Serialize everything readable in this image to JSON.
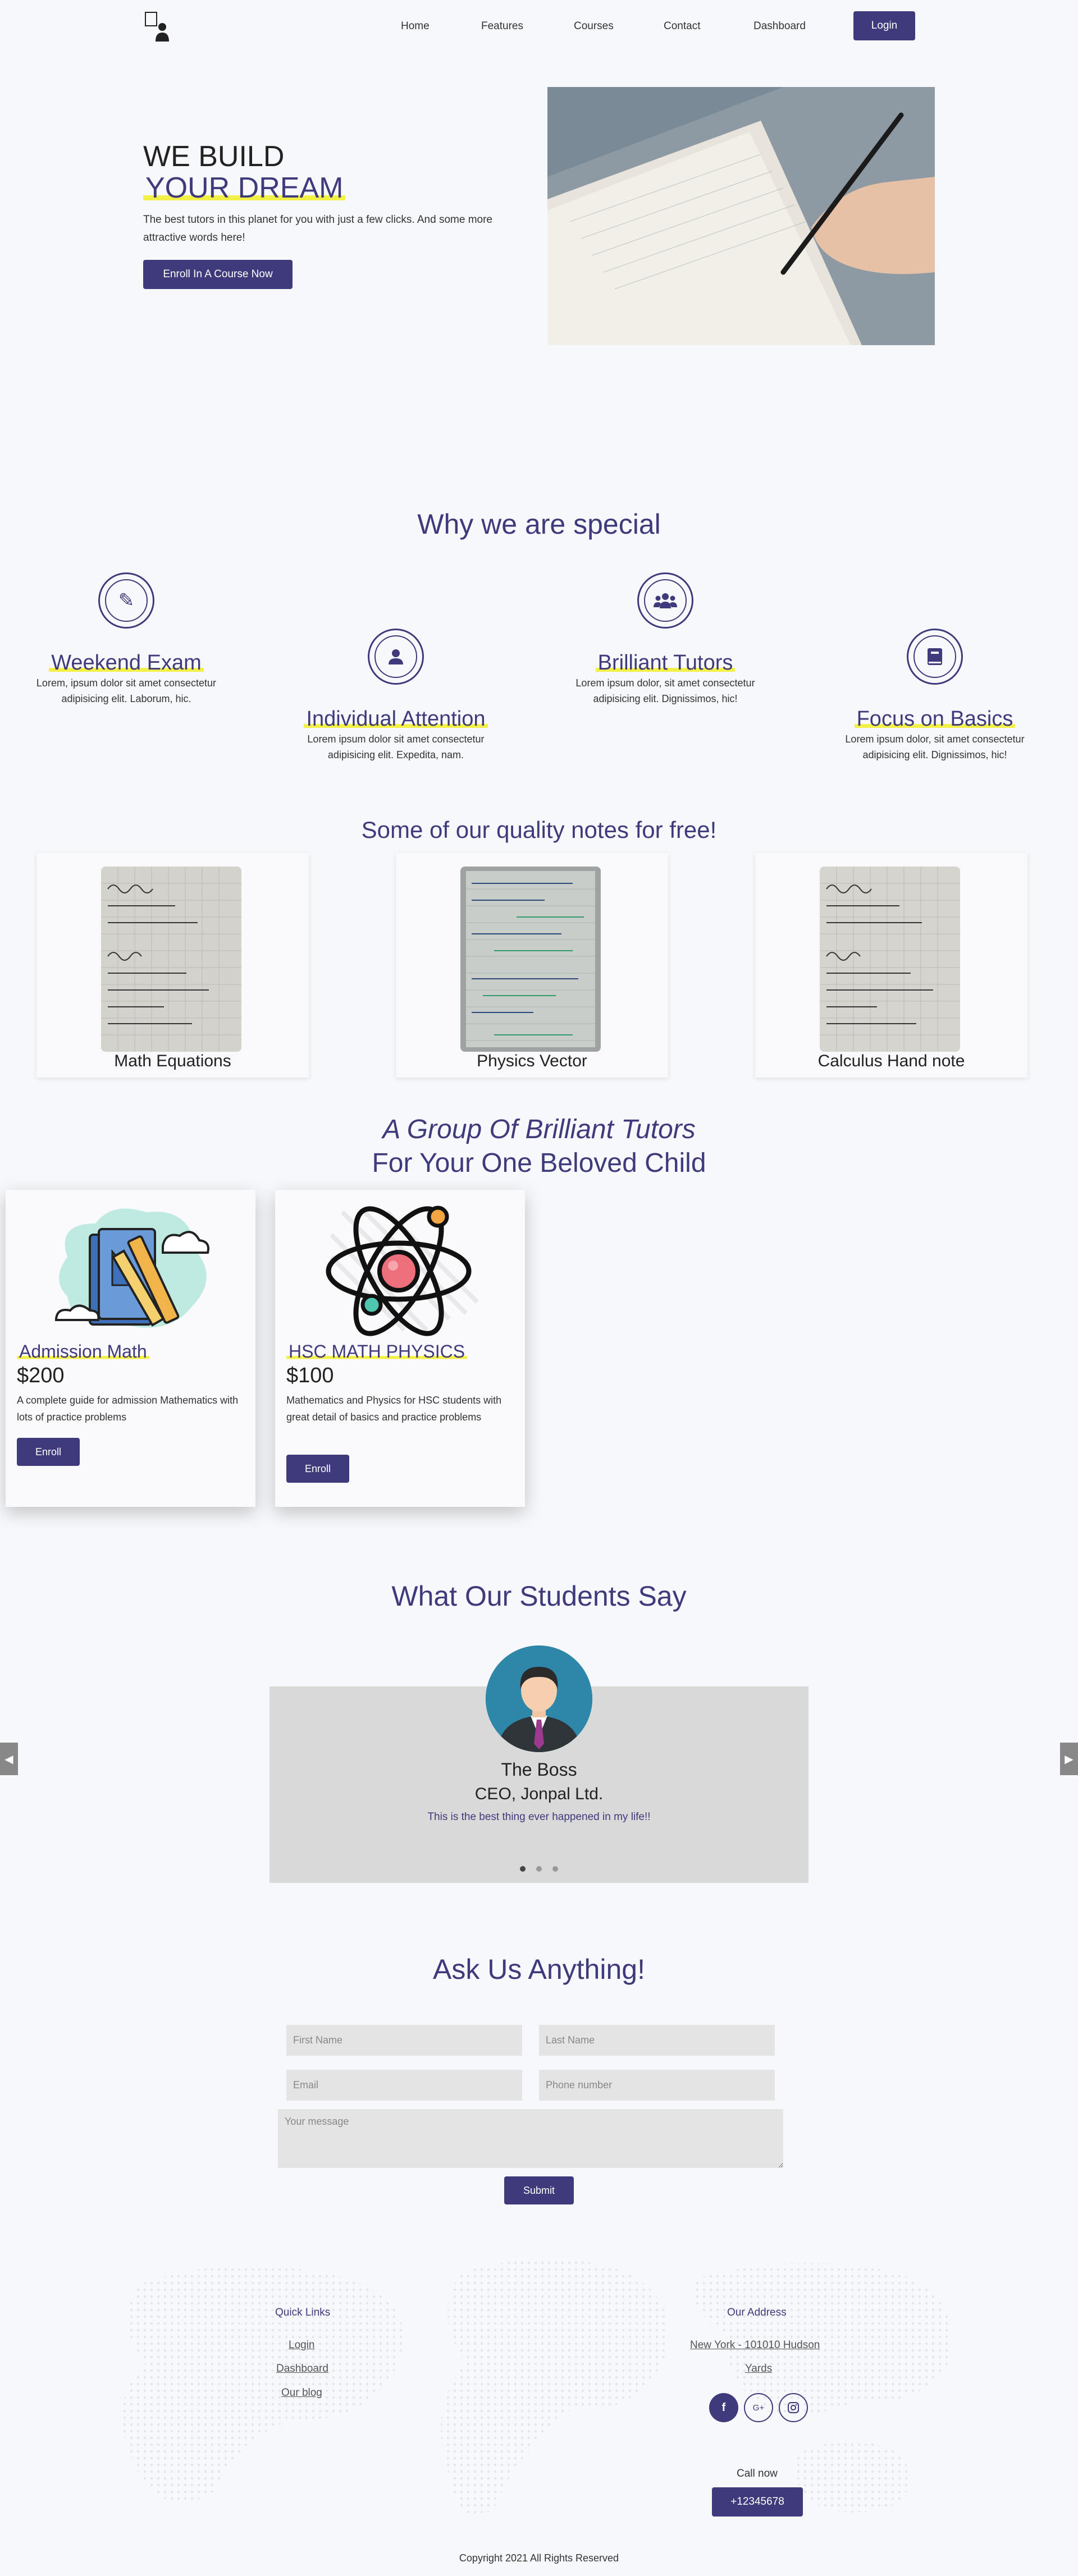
{
  "nav": {
    "links": [
      "Home",
      "Features",
      "Courses",
      "Contact",
      "Dashboard"
    ],
    "login_label": "Login"
  },
  "hero": {
    "line1": "WE BUILD",
    "line2": "YOUR DREAM",
    "paragraph": "The best tutors in this planet for you with just a few clicks. And some more attractive words here!",
    "cta_label": "Enroll In A Course Now"
  },
  "features": {
    "title": "Why we are special",
    "items": [
      {
        "title": "Weekend Exam",
        "desc": "Lorem, ipsum dolor sit amet consectetur adipisicing elit. Laborum, hic.",
        "icon": "pencil-icon"
      },
      {
        "title": "Individual Attention",
        "desc": "Lorem ipsum dolor sit amet consectetur adipisicing elit. Expedita, nam.",
        "icon": "user-icon"
      },
      {
        "title": "Brilliant Tutors",
        "desc": "Lorem ipsum dolor, sit amet consectetur adipisicing elit. Dignissimos, hic!",
        "icon": "users-icon"
      },
      {
        "title": "Focus on Basics",
        "desc": "Lorem ipsum dolor, sit amet consectetur adipisicing elit. Dignissimos, hic!",
        "icon": "book-icon"
      }
    ]
  },
  "notes": {
    "title": "Some of our quality notes for free!",
    "items": [
      "Math Equations",
      "Physics Vector",
      "Calculus Hand note"
    ]
  },
  "tutors": {
    "title_line1": "A Group Of Brilliant Tutors",
    "title_line2": "For Your One Beloved Child"
  },
  "courses": [
    {
      "title": "Admission Math",
      "price": "$200",
      "desc": "A complete guide for admission Mathematics with lots of practice problems",
      "button": "Enroll"
    },
    {
      "title": "HSC MATH PHYSICS",
      "price": "$100",
      "desc": "Mathematics and Physics for HSC students with great detail of basics and practice problems",
      "button": "Enroll"
    }
  ],
  "testimonials": {
    "title": "What Our Students Say",
    "name": "The Boss",
    "role": "CEO, Jonpal Ltd.",
    "quote": "This is the best thing ever happened in my life!!"
  },
  "contact": {
    "title": "Ask Us Anything!",
    "first_name": "First Name",
    "last_name": "Last Name",
    "email": "Email",
    "phone": "Phone number",
    "message": "Your message",
    "submit": "Submit"
  },
  "footer": {
    "quick_links_title": "Quick Links",
    "links": [
      "Login",
      "Dashboard",
      "Our blog"
    ],
    "address_title": "Our Address",
    "address_line1": "New York - 101010 Hudson",
    "address_line2": "Yards",
    "call_label": "Call now",
    "phone": "+12345678",
    "copyright": "Copyright 2021 All Rights Reserved"
  },
  "colors": {
    "brand": "#3f3a7b",
    "highlight": "#f4f04a",
    "background": "#f7f8fb"
  }
}
